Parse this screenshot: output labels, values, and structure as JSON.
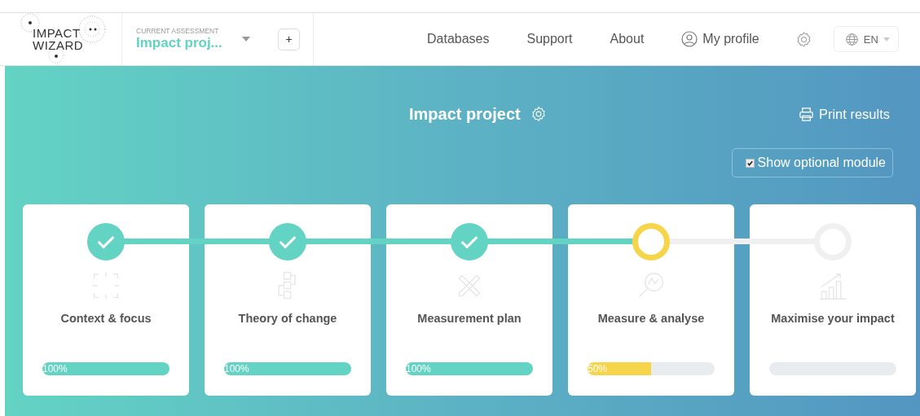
{
  "logo": {
    "line_1": "IMPACT",
    "line_2": "WIZARD"
  },
  "assessment": {
    "label": "CURRENT ASSESSMENT",
    "name": "Impact proj...",
    "add": "+"
  },
  "nav": [
    {
      "label": "Databases",
      "kind": "link"
    },
    {
      "label": "Support",
      "kind": "link"
    },
    {
      "label": "About",
      "kind": "link"
    },
    {
      "label": "My profile",
      "kind": "profile"
    }
  ],
  "language": {
    "label": "EN"
  },
  "project": {
    "title": "Impact project",
    "print": "Print results",
    "optional": {
      "label": "Show optional module",
      "checked": true
    }
  },
  "steps": [
    {
      "title": "Context & focus",
      "completed": true,
      "active": false,
      "level": 1,
      "reading": "100%"
    },
    {
      "title": "Theory of change",
      "completed": true,
      "active": false,
      "level": 1,
      "reading": "100%"
    },
    {
      "title": "Measurement plan",
      "completed": true,
      "active": false,
      "level": 1,
      "reading": "100%"
    },
    {
      "title": "Measure & analyse",
      "completed": false,
      "active": true,
      "level": 0.5,
      "reading": "50%"
    },
    {
      "title": "Maximise your impact",
      "completed": false,
      "active": false,
      "level": 0
    }
  ]
}
